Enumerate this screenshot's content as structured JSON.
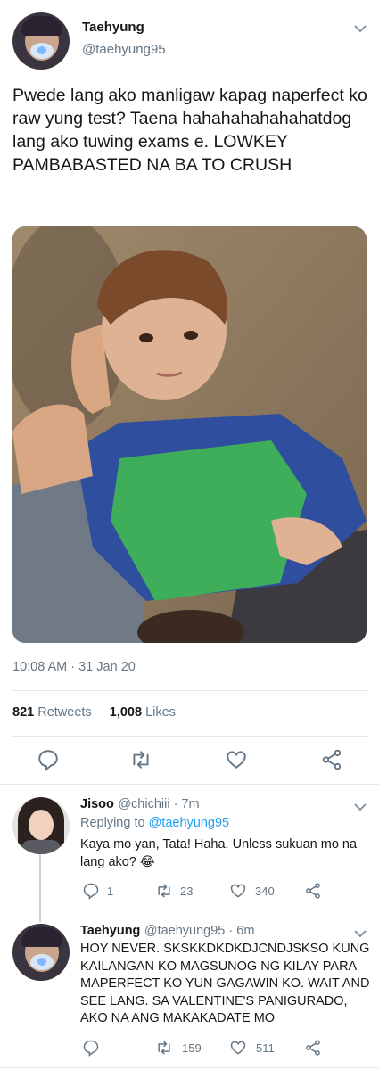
{
  "main_tweet": {
    "name": "Taehyung",
    "handle": "@taehyung95",
    "text": "Pwede lang ako manligaw kapag naperfect ko raw yung test? Taena hahahahahahahatdog lang ako tuwing exams e. LOWKEY PAMBABASTED NA BA TO CRUSH",
    "timestamp": "10:08 AM · 31 Jan 20",
    "retweets_count": "821",
    "retweets_label": "Retweets",
    "likes_count": "1,008",
    "likes_label": "Likes"
  },
  "replies": [
    {
      "name": "Jisoo",
      "handle_time": "@chichiii · 7m",
      "replying_prefix": "Replying to",
      "replying_to": "@taehyung95",
      "text": "Kaya mo yan, Tata! Haha. Unless sukuan mo na lang ako? 😂",
      "reply_count": "1",
      "retweet_count": "23",
      "like_count": "340"
    },
    {
      "name": "Taehyung",
      "handle_time": "@taehyung95 · 6m",
      "text": "HOY NEVER. SKSKKDKDKDJCNDJSKSO KUNG KAILANGAN KO MAGSUNOG NG KILAY PARA MAPERFECT KO YUN GAGAWIN KO. WAIT AND SEE LANG. SA VALENTINE'S PANIGURADO, AKO NA ANG MAKAKADATE MO",
      "reply_count": "",
      "retweet_count": "159",
      "like_count": "511"
    }
  ],
  "icons": {
    "reply": "reply-icon",
    "retweet": "retweet-icon",
    "like": "heart-icon",
    "share": "share-icon",
    "caret": "chevron-down-icon"
  },
  "colors": {
    "link": "#1da1f2",
    "secondary": "#657786",
    "divider": "#e1e8ed"
  }
}
